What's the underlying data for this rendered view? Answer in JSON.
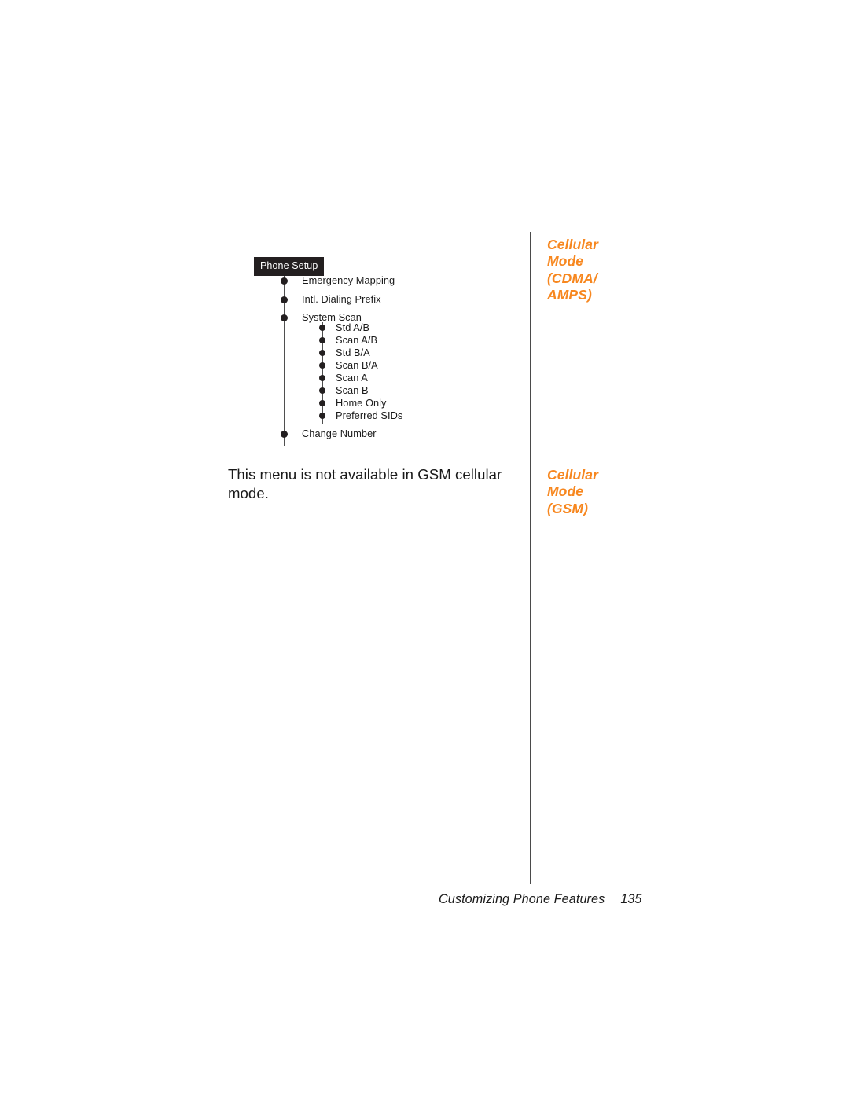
{
  "page": {
    "footer": {
      "title": "Customizing Phone Features",
      "page_number": "135"
    },
    "body_text": "This menu is not available in GSM cellular mode.",
    "accent_color": "#F7871F",
    "text_color": "#1a1a1a",
    "chip_background": "#231f20",
    "divider_color": "#4a4a4a"
  },
  "margin_notes": [
    {
      "name": "cellular-mode-cdma-amps",
      "lines": [
        "Cellular",
        "Mode",
        "(CDMA/",
        "AMPS)"
      ]
    },
    {
      "name": "cellular-mode-gsm",
      "lines": [
        "Cellular",
        "Mode",
        "(GSM)"
      ]
    }
  ],
  "menu_tree": {
    "root_label": "Phone Setup",
    "items": [
      {
        "label": "Emergency Mapping",
        "level": 1
      },
      {
        "label": "Intl. Dialing Prefix",
        "level": 1
      },
      {
        "label": "System Scan",
        "level": 1
      },
      {
        "label": "Std A/B",
        "level": 2
      },
      {
        "label": "Scan A/B",
        "level": 2
      },
      {
        "label": "Std B/A",
        "level": 2
      },
      {
        "label": "Scan B/A",
        "level": 2
      },
      {
        "label": "Scan A",
        "level": 2
      },
      {
        "label": "Scan B",
        "level": 2
      },
      {
        "label": "Home Only",
        "level": 2
      },
      {
        "label": "Preferred SIDs",
        "level": 2
      },
      {
        "label": "Change Number",
        "level": 1
      }
    ]
  }
}
